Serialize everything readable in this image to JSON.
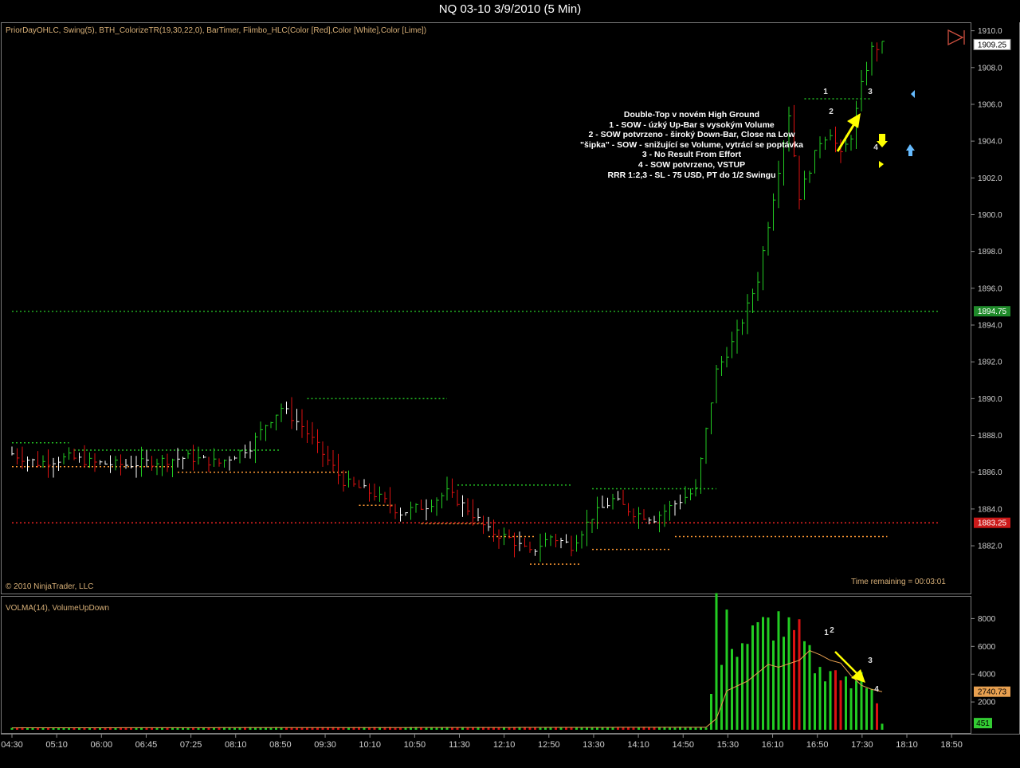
{
  "window": {
    "title": "NQ 03-10  3/9/2010 (5 Min)"
  },
  "price_panel": {
    "indicators": "PriorDayOHLC, Swing(5), BTH_ColorizeTR(19,30,22,0), BarTimer, Flimbo_HLC(Color [Red],Color [White],Color [Lime])",
    "copyright": "© 2010 NinjaTrader, LLC",
    "time_remaining": "Time remaining = 00:03:01",
    "annotation": [
      "Double-Top v novém High Ground",
      "1 - SOW - úzký Up-Bar s vysokým Volume",
      "2 - SOW potvrzeno - široký Down-Bar, Close na Low",
      "\"šipka\" - SOW - snižující se Volume, vytrácí se poptávka",
      "3 - No Result From Effort",
      "4 - SOW potvrzeno, VSTUP",
      "RRR 1:2,3 - SL - 75 USD, PT do 1/2 Swingu"
    ],
    "bar_numbers": [
      "1",
      "2",
      "3",
      "4"
    ],
    "colors": {
      "up": "#22cc22",
      "down": "#dd1111",
      "neutral": "#ffffff",
      "swing_high": "#22bb22",
      "swing_low": "#ff9933",
      "prior_high": "#22aa22",
      "prior_low": "#ee2222",
      "arrow": "#ffff00",
      "buy_arrow": "#66bbff"
    }
  },
  "volume_panel": {
    "indicators": "VOLMA(14), VolumeUpDown",
    "bar_numbers": [
      "1",
      "2",
      "3",
      "4"
    ]
  },
  "chart_data": [
    {
      "type": "ohlc",
      "title": "NQ 03-10  3/9/2010 (5 Min)",
      "x_ticks": [
        "04:30",
        "05:10",
        "06:00",
        "06:45",
        "07:25",
        "08:10",
        "08:50",
        "09:30",
        "10:10",
        "10:50",
        "11:30",
        "12:10",
        "12:50",
        "13:30",
        "14:10",
        "14:50",
        "15:30",
        "16:10",
        "16:50",
        "17:30",
        "18:10",
        "18:50"
      ],
      "y_ticks": [
        1882,
        1884,
        1886,
        1888,
        1890,
        1892,
        1894,
        1896,
        1898,
        1900,
        1902,
        1904,
        1906,
        1908,
        1910
      ],
      "ylim": [
        1880.4,
        1910.2
      ],
      "reference_levels": {
        "prior_day_high": 1894.75,
        "prior_day_low": 1883.25
      },
      "price_markers": [
        {
          "label": "1909.25",
          "value": 1909.25
        },
        {
          "label": "1894.75",
          "value": 1894.75
        },
        {
          "label": "1883.25",
          "value": 1883.25
        }
      ],
      "price_keys": [
        [
          0,
          1887.0
        ],
        [
          5,
          1886.5
        ],
        [
          11,
          1886.8
        ],
        [
          16,
          1886.5
        ],
        [
          22,
          1886.4
        ],
        [
          28,
          1886.6
        ],
        [
          34,
          1886.8
        ],
        [
          40,
          1886.5
        ],
        [
          46,
          1887.4
        ],
        [
          49,
          1888.6
        ],
        [
          52,
          1889.5
        ],
        [
          56,
          1888.5
        ],
        [
          60,
          1887.0
        ],
        [
          64,
          1885.5
        ],
        [
          70,
          1884.8
        ],
        [
          75,
          1883.8
        ],
        [
          80,
          1884.2
        ],
        [
          84,
          1884.9
        ],
        [
          88,
          1884.0
        ],
        [
          92,
          1882.8
        ],
        [
          96,
          1882.4
        ],
        [
          100,
          1881.6
        ],
        [
          104,
          1882.5
        ],
        [
          108,
          1882.0
        ],
        [
          112,
          1883.6
        ],
        [
          116,
          1884.5
        ],
        [
          120,
          1883.8
        ],
        [
          124,
          1883.5
        ],
        [
          128,
          1884.3
        ],
        [
          132,
          1885.0
        ],
        [
          136,
          1891.5
        ],
        [
          140,
          1893.5
        ],
        [
          144,
          1896.5
        ],
        [
          148,
          1902.5
        ],
        [
          150,
          1905.5
        ],
        [
          152,
          1901.0
        ],
        [
          156,
          1904.0
        ],
        [
          158,
          1904.5
        ],
        [
          160,
          1903.2
        ],
        [
          162,
          1904.3
        ],
        [
          164,
          1907.0
        ],
        [
          166,
          1909.0
        ],
        [
          168,
          1909.2
        ]
      ]
    },
    {
      "type": "bar",
      "title": "VOLMA(14), VolumeUpDown",
      "y_ticks": [
        2000,
        4000,
        6000,
        8000
      ],
      "ylim": [
        0,
        9400
      ],
      "last_volume_ma": "2740.73",
      "last_volume": "451",
      "volume_keys": [
        [
          0,
          150
        ],
        [
          134,
          180
        ],
        [
          135,
          2500
        ],
        [
          136,
          9300
        ],
        [
          137,
          4800
        ],
        [
          138,
          7400
        ],
        [
          140,
          6000
        ],
        [
          142,
          6400
        ],
        [
          144,
          7000
        ],
        [
          146,
          7500
        ],
        [
          148,
          7800
        ],
        [
          150,
          6900
        ],
        [
          152,
          6700
        ],
        [
          154,
          5200
        ],
        [
          156,
          4100
        ],
        [
          158,
          4500
        ],
        [
          160,
          3800
        ],
        [
          162,
          2900
        ],
        [
          164,
          4800
        ],
        [
          165,
          3500
        ],
        [
          166,
          3200
        ],
        [
          168,
          400
        ]
      ],
      "ma_keys": [
        [
          0,
          140
        ],
        [
          134,
          180
        ],
        [
          136,
          800
        ],
        [
          138,
          2800
        ],
        [
          142,
          3500
        ],
        [
          146,
          4700
        ],
        [
          148,
          4500
        ],
        [
          152,
          5000
        ],
        [
          154,
          5700
        ],
        [
          156,
          5400
        ],
        [
          158,
          5000
        ],
        [
          160,
          4800
        ],
        [
          162,
          3900
        ],
        [
          164,
          3200
        ],
        [
          166,
          2900
        ],
        [
          168,
          2740
        ]
      ]
    }
  ]
}
